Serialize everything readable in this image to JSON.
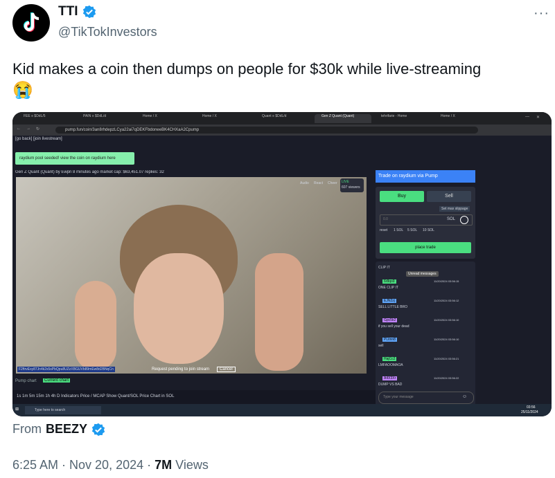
{
  "author": {
    "name": "TTI",
    "handle": "@TikTokInvestors",
    "avatar_icon": "tiktok-logo-icon"
  },
  "tweet": {
    "text": "Kid makes a coin then dumps on people for $30k while live-streaming",
    "emoji": "😭"
  },
  "media": {
    "browser": {
      "tabs": [
        "FEE ≡ $DdL/5",
        "PAIN ≡ $DdL/d",
        "Home / X",
        "Home / X",
        "Quant ≡ $DdL/d",
        "Gen Z Quant (Quant)",
        "tehrifarie - Home",
        "Home / X"
      ],
      "url": "pump.fun/coin/3an8rhdepzLCya22ai7qDEKFbdoneeBK4CHXaA2Cpump"
    },
    "page": {
      "back_links": "[go back]   [join livestream]",
      "banner_text": "raydium pool seeded! view the coin on raydium here",
      "coin_header": "Gen Z Quant (Quant)   by  Ewpn   8 minutes ago   market cap: $63,451.07   replies: 32",
      "live_label": "LIVE",
      "viewers": "607 viewers",
      "video_buttons": [
        "Audio",
        "React",
        "Cheer"
      ],
      "overlay_address": "F2ftrvEsy87Jn4k2s5sPbQpu8UZzXBGUVb89mEw8d2BNqCn",
      "request_text": "Request pending to join stream",
      "cancel_label": "Cancel",
      "pump_chart_label": "Pump chart",
      "current_chart_label": "Current chart",
      "chart_toolbar": "1s  1m  5m  15m  1h  4h  D   Indicators   Price / MCAP   Show Quant/SOL Price Chart in SOL"
    },
    "trade": {
      "header": "Trade on raydium via Pump",
      "buy_label": "Buy",
      "sell_label": "Sell",
      "slippage_label": "Set max slippage",
      "amount_placeholder": "0.0",
      "currency": "SOL",
      "presets": [
        "reset",
        "1 SOL",
        "5 SOL",
        "10 SOL"
      ],
      "place_trade_label": "place trade"
    },
    "chat": {
      "title": "CLIP IT",
      "unread_label": "Unread messages",
      "messages": [
        {
          "user": "6r8qo9",
          "time": "11/20/2024 03:56:15",
          "text": "ONE CLIP IT"
        },
        {
          "user": "EJN2zj",
          "time": "11/20/2024 03:56:12",
          "text": "SELL LITTLE BRO"
        },
        {
          "user": "Gpc5k2",
          "time": "11/20/2024 03:56:10",
          "text": "if you sell your dead"
        },
        {
          "user": "PLitnn8",
          "time": "11/20/2024 03:56:10",
          "text": "sell"
        },
        {
          "user": "HajCc2",
          "time": "11/20/2024 03:56:21",
          "text": "LMFAOOMAOA"
        },
        {
          "user": "A4X3Xr",
          "time": "11/20/2024 03:56:22",
          "text": "DUMP VS BAD"
        }
      ],
      "input_placeholder": "Type your message"
    },
    "taskbar": {
      "search_placeholder": "Type here to search",
      "clock_time": "03:56",
      "clock_date": "25/11/2024"
    }
  },
  "footer": {
    "from_label": "From",
    "from_name": "BEEZY",
    "time": "6:25 AM · Nov 20, 2024 · ",
    "views_count": "7M",
    "views_label": " Views"
  },
  "colors": {
    "verified": "#1d9bf0",
    "accent_green": "#4ade80",
    "accent_blue": "#3b82f6"
  }
}
